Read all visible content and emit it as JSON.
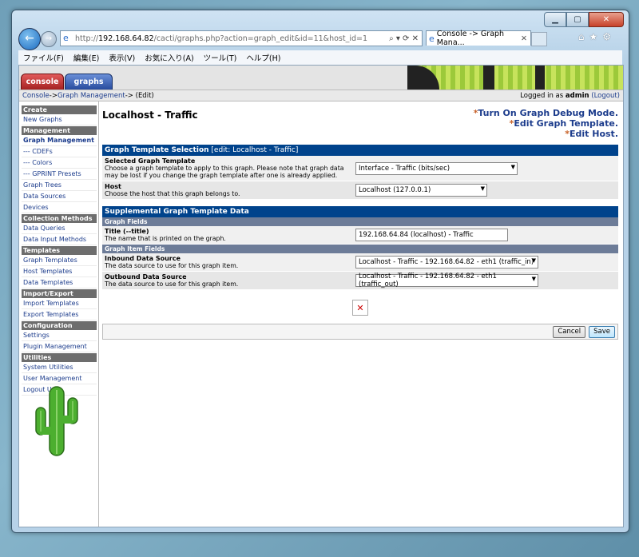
{
  "browser": {
    "url_prefix": "http://",
    "url_host": "192.168.64.82",
    "url_rest": "/cacti/graphs.php?action=graph_edit&id=11&host_id=1",
    "address_tools": "⌕ ▾ ⟳ ✕",
    "tab_title": "Console -> Graph Mana...",
    "menu": [
      "ファイル(F)",
      "編集(E)",
      "表示(V)",
      "お気に入り(A)",
      "ツール(T)",
      "ヘルプ(H)"
    ]
  },
  "cacti": {
    "tab_console": "console",
    "tab_graphs": "graphs",
    "breadcrumb": {
      "console": "Console",
      "sep1": " -> ",
      "graph_mgmt": "Graph Management",
      "sep2": " -> (Edit)",
      "logged_in": "Logged in as ",
      "user": "admin",
      "logout": " (Logout)"
    },
    "sidebar": [
      {
        "type": "hdr",
        "label": "Create"
      },
      {
        "type": "it",
        "label": "New Graphs"
      },
      {
        "type": "hdr",
        "label": "Management"
      },
      {
        "type": "it",
        "label": "Graph Management",
        "bold": true
      },
      {
        "type": "it",
        "label": "--- CDEFs"
      },
      {
        "type": "it",
        "label": "--- Colors"
      },
      {
        "type": "it",
        "label": "--- GPRINT Presets"
      },
      {
        "type": "it",
        "label": "Graph Trees"
      },
      {
        "type": "it",
        "label": "Data Sources"
      },
      {
        "type": "it",
        "label": "Devices"
      },
      {
        "type": "hdr",
        "label": "Collection Methods"
      },
      {
        "type": "it",
        "label": "Data Queries"
      },
      {
        "type": "it",
        "label": "Data Input Methods"
      },
      {
        "type": "hdr",
        "label": "Templates"
      },
      {
        "type": "it",
        "label": "Graph Templates"
      },
      {
        "type": "it",
        "label": "Host Templates"
      },
      {
        "type": "it",
        "label": "Data Templates"
      },
      {
        "type": "hdr",
        "label": "Import/Export"
      },
      {
        "type": "it",
        "label": "Import Templates"
      },
      {
        "type": "it",
        "label": "Export Templates"
      },
      {
        "type": "hdr",
        "label": "Configuration"
      },
      {
        "type": "it",
        "label": "Settings"
      },
      {
        "type": "it",
        "label": "Plugin Management"
      },
      {
        "type": "hdr",
        "label": "Utilities"
      },
      {
        "type": "it",
        "label": "System Utilities"
      },
      {
        "type": "it",
        "label": "User Management"
      },
      {
        "type": "it",
        "label": "Logout User"
      }
    ],
    "page_title": "Localhost - Traffic",
    "links": {
      "debug": "Turn On Graph Debug Mode.",
      "edit_template": "Edit Graph Template.",
      "edit_host": "Edit Host.",
      "star": "*"
    },
    "section1": {
      "title": "Graph Template Selection",
      "edit_note": " [edit: Localhost - Traffic]",
      "template_label": "Selected Graph Template",
      "template_desc": "Choose a graph template to apply to this graph. Please note that graph data may be lost if you change the graph template after one is already applied.",
      "template_value": "Interface - Traffic (bits/sec)",
      "host_label": "Host",
      "host_desc": "Choose the host that this graph belongs to.",
      "host_value": "Localhost (127.0.0.1)"
    },
    "section2": {
      "title": "Supplemental Graph Template Data",
      "graph_fields": "Graph Fields",
      "title_label": "Title (--title)",
      "title_desc": "The name that is printed on the graph.",
      "title_value": "192.168.64.84 (localhost) - Traffic",
      "item_fields": "Graph Item Fields",
      "inbound_label": "Inbound Data Source",
      "inbound_desc": "The data source to use for this graph item.",
      "inbound_value": "Localhost - Traffic - 192.168.64.82 - eth1 (traffic_in)",
      "outbound_label": "Outbound Data Source",
      "outbound_desc": "The data source to use for this graph item.",
      "outbound_value": "Localhost - Traffic - 192.168.64.82 - eth1 (traffic_out)"
    },
    "buttons": {
      "cancel": "Cancel",
      "save": "Save"
    }
  }
}
